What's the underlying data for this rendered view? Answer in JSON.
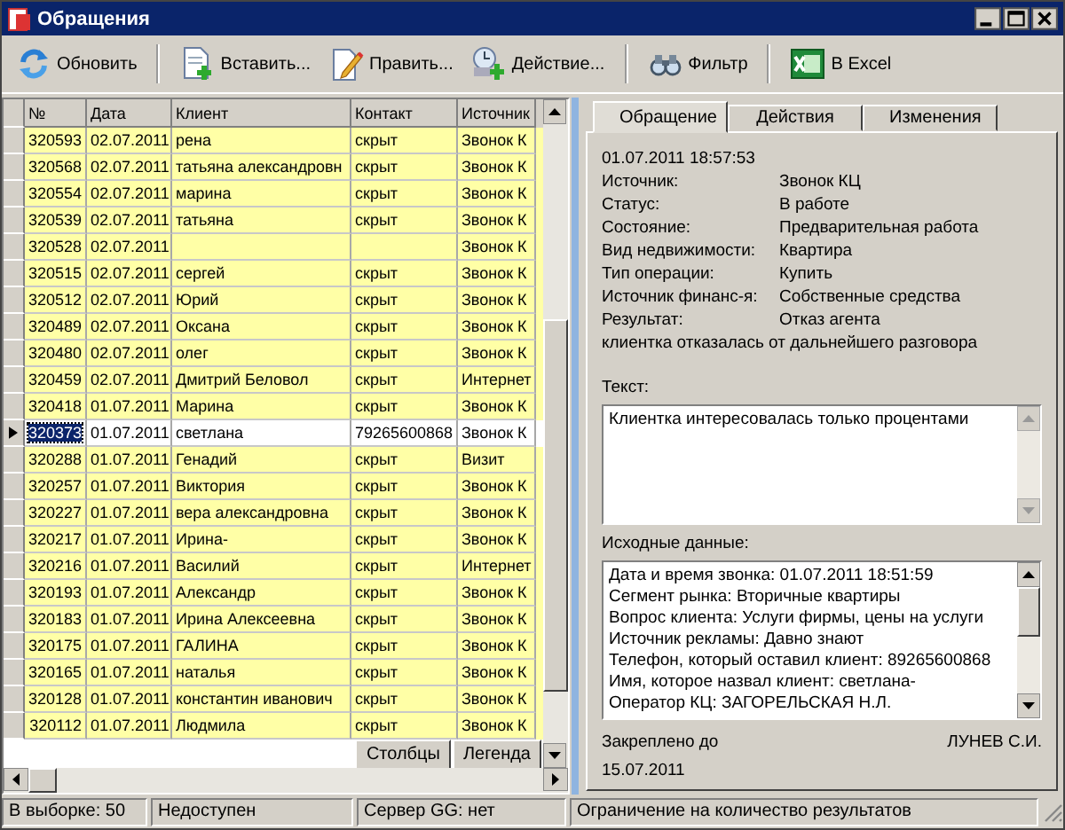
{
  "window": {
    "title": "Обращения"
  },
  "toolbar": [
    {
      "kind": "refresh",
      "label": "Обновить"
    },
    {
      "kind": "insert",
      "label": "Вставить..."
    },
    {
      "kind": "edit",
      "label": "Править..."
    },
    {
      "kind": "action",
      "label": "Действие..."
    },
    {
      "kind": "filter",
      "label": "Фильтр"
    },
    {
      "kind": "excel",
      "label": "В Excel"
    }
  ],
  "table": {
    "columns": [
      "№",
      "Дата",
      "Клиент",
      "Контакт",
      "Источник"
    ],
    "rows": [
      {
        "cells": [
          "320593",
          "02.07.2011",
          "рена",
          "скрыт",
          "Звонок К"
        ],
        "selected": false
      },
      {
        "cells": [
          "320568",
          "02.07.2011",
          "татьяна александровн",
          "скрыт",
          "Звонок К"
        ],
        "selected": false
      },
      {
        "cells": [
          "320554",
          "02.07.2011",
          "марина",
          "скрыт",
          "Звонок К"
        ],
        "selected": false
      },
      {
        "cells": [
          "320539",
          "02.07.2011",
          "татьяна",
          "скрыт",
          "Звонок К"
        ],
        "selected": false
      },
      {
        "cells": [
          "320528",
          "02.07.2011",
          "",
          "",
          "Звонок К"
        ],
        "selected": false
      },
      {
        "cells": [
          "320515",
          "02.07.2011",
          "сергей",
          "скрыт",
          "Звонок К"
        ],
        "selected": false
      },
      {
        "cells": [
          "320512",
          "02.07.2011",
          "Юрий",
          "скрыт",
          "Звонок К"
        ],
        "selected": false
      },
      {
        "cells": [
          "320489",
          "02.07.2011",
          "Оксана",
          "скрыт",
          "Звонок К"
        ],
        "selected": false
      },
      {
        "cells": [
          "320480",
          "02.07.2011",
          "олег",
          "скрыт",
          "Звонок К"
        ],
        "selected": false
      },
      {
        "cells": [
          "320459",
          "02.07.2011",
          "Дмитрий Беловол",
          "скрыт",
          "Интернет"
        ],
        "selected": false
      },
      {
        "cells": [
          "320418",
          "01.07.2011",
          "Марина",
          "скрыт",
          "Звонок К"
        ],
        "selected": false
      },
      {
        "cells": [
          "320373",
          "01.07.2011",
          "светлана",
          "79265600868",
          "Звонок К"
        ],
        "selected": true
      },
      {
        "cells": [
          "320288",
          "01.07.2011",
          "Генадий",
          "скрыт",
          "Визит"
        ],
        "selected": false
      },
      {
        "cells": [
          "320257",
          "01.07.2011",
          "Виктория",
          "скрыт",
          "Звонок К"
        ],
        "selected": false
      },
      {
        "cells": [
          "320227",
          "01.07.2011",
          "вера александровна",
          "скрыт",
          "Звонок К"
        ],
        "selected": false
      },
      {
        "cells": [
          "320217",
          "01.07.2011",
          "Ирина-",
          "скрыт",
          "Звонок К"
        ],
        "selected": false
      },
      {
        "cells": [
          "320216",
          "01.07.2011",
          "Василий",
          "скрыт",
          "Интернет"
        ],
        "selected": false
      },
      {
        "cells": [
          "320193",
          "01.07.2011",
          "Александр",
          "скрыт",
          "Звонок К"
        ],
        "selected": false
      },
      {
        "cells": [
          "320183",
          "01.07.2011",
          "Ирина Алексеевна",
          "скрыт",
          "Звонок К"
        ],
        "selected": false
      },
      {
        "cells": [
          "320175",
          "01.07.2011",
          "ГАЛИНА",
          "скрыт",
          "Звонок К"
        ],
        "selected": false
      },
      {
        "cells": [
          "320165",
          "01.07.2011",
          "наталья",
          "скрыт",
          "Звонок К"
        ],
        "selected": false
      },
      {
        "cells": [
          "320128",
          "01.07.2011",
          "константин иванович",
          "скрыт",
          "Звонок К"
        ],
        "selected": false
      },
      {
        "cells": [
          "320112",
          "01.07.2011",
          "Людмила",
          "скрыт",
          "Звонок К"
        ],
        "selected": false
      }
    ],
    "buttons": [
      "Столбцы",
      "Легенда"
    ]
  },
  "details": {
    "tabs": [
      {
        "label": "Обращение",
        "selected": true
      },
      {
        "label": "Действия",
        "selected": false
      },
      {
        "label": "Изменения",
        "selected": false
      }
    ],
    "timestamp": "01.07.2011 18:57:53",
    "fields": [
      {
        "label": "Источник:",
        "value": "Звонок КЦ"
      },
      {
        "label": "Статус:",
        "value": "В работе"
      },
      {
        "label": "Состояние:",
        "value": "Предварительная работа"
      },
      {
        "label": "Вид недвижимости:",
        "value": "Квартира"
      },
      {
        "label": "Тип операции:",
        "value": "Купить"
      },
      {
        "label": "Источник финанс-я:",
        "value": "Собственные средства"
      },
      {
        "label": "Результат:",
        "value": "Отказ агента"
      }
    ],
    "result_note": "клиентка отказалась от дальнейшего разговора",
    "text_label": "Текст:",
    "text_value": "Клиентка интересовалась только процентами",
    "source_label": "Исходные данные:",
    "source_lines": [
      "Дата и время звонка: 01.07.2011 18:51:59",
      "Сегмент рынка: Вторичные квартиры",
      "Вопрос клиента: Услуги фирмы, цены на услуги",
      "Источник рекламы: Давно знают",
      "Телефон, который оставил клиент: 89265600868",
      "Имя, которое назвал клиент: светлана-",
      "Оператор КЦ: ЗАГОРЕЛЬСКАЯ Н.Л."
    ],
    "pinned_label": "Закреплено до",
    "pinned_date": "15.07.2011",
    "agent": "ЛУНЕВ С.И."
  },
  "status_bar": [
    "В выборке: 50",
    "Недоступен",
    "Сервер GG: нет",
    "Ограничение на количество результатов"
  ]
}
